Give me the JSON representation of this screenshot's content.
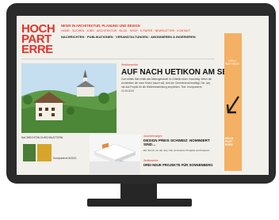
{
  "site": {
    "logo_line1": "HOCH",
    "logo_line2": "PART",
    "logo_line3": "ERRE",
    "tagline": "NEWS IN ARCHITEKTUR, PLANUNG UND DESIGN",
    "topnav": "HOME · SUCHEN · JOBS · ARCHITEKTUR · BLOG · SHOP · E-PAPER · NEWSLETTER · KONTAKT",
    "mainnav": "NACHRICHTEN · PUBLIKATIONEN · VERANSTALTUNGEN · ABONNIEREN & INSERIEREN"
  },
  "hero": {
    "meta": "Wettbewerbe",
    "title": "AUF NACH UETIKON AM SEE?",
    "body": "Zum dritten Mal erhält das Ateliergebäude im Ortsbild einen Vorschlag: Wenn die Architekten die neue Kirche bauen will, wird der Gemeinderat bewilligt. Die Jury hat das Projekt für die Weiterbearbeitung empfohlen. Text: Hochparterre, 21.05.2013"
  },
  "lower": {
    "left_heading": "NACHRICHTEN DURCHBLÄTTERN",
    "mid_label": "Hochparterre 5/2013",
    "right_meta": "Auszeichnungen",
    "right_title": "DESIGN PREIS SCHWEIZ: NOMINIERT SIND…",
    "right_body": "Ein Termin vor der Jury: Die nominierten Projekte sind bekannt.",
    "right2_meta": "Wettbewerbe",
    "right2_title": "DREI NEUE PROJEKTE FÜR SONNENBERG"
  },
  "ad": {
    "top_text": "HOCH PART ERRE",
    "bottom_text": "HOCH\nPART\nERRE"
  },
  "colors": {
    "brand_red": "#e5332a",
    "ad_orange": "#f4b063",
    "monitor": "#2b2b2b"
  }
}
